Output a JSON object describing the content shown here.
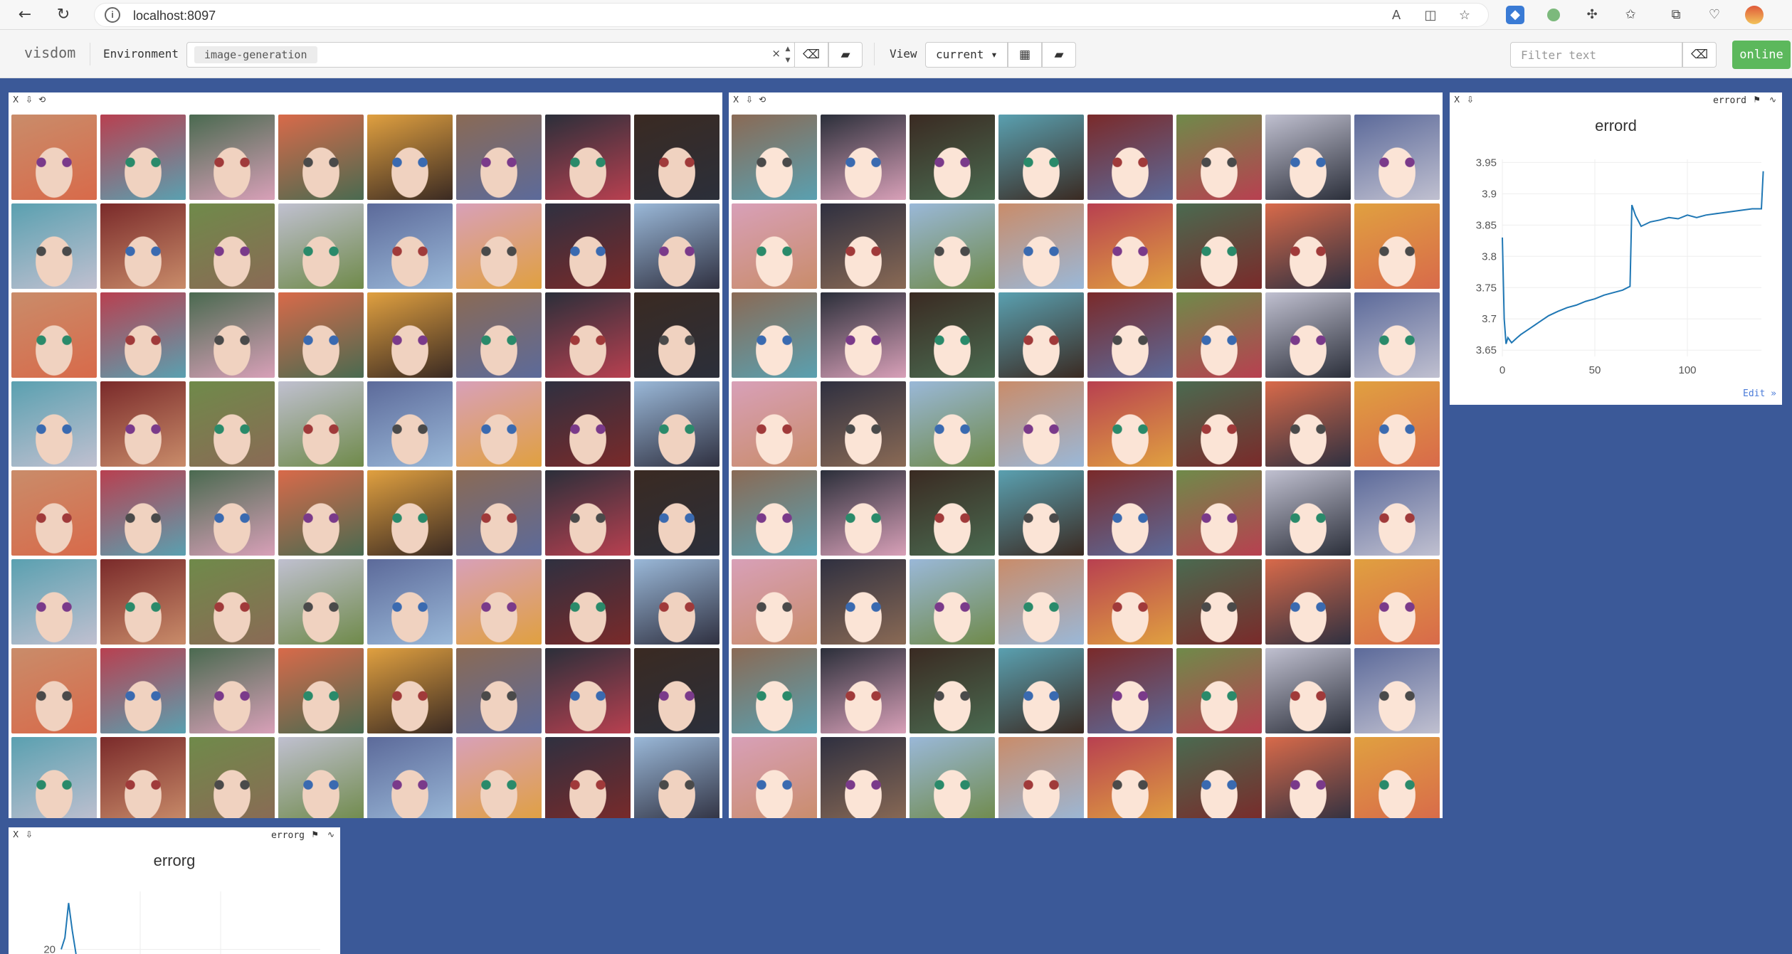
{
  "browser": {
    "url": "localhost:8097",
    "back_icon": "back-arrow-icon",
    "reload_icon": "reload-icon"
  },
  "visdom": {
    "brand": "visdom",
    "environment_label": "Environment",
    "environment_value": "image-generation",
    "clear_symbol": "×",
    "view_label": "View",
    "view_value": "current ▾",
    "filter_placeholder": "Filter text",
    "status": "online"
  },
  "panes": {
    "images_fake": {
      "controls": [
        "X",
        "⇩",
        "⟲"
      ],
      "rows": 8,
      "cols": 8
    },
    "images_real": {
      "controls": [
        "X",
        "⇩",
        "⟲"
      ],
      "rows": 8,
      "cols": 8
    },
    "errord": {
      "controls": [
        "X",
        "⇩"
      ],
      "title_tag": "errord",
      "edit_link": "Edit »"
    },
    "errorg": {
      "controls": [
        "X",
        "⇩"
      ],
      "title_tag": "errorg"
    }
  },
  "colors": {
    "page_bg": "#3b5998",
    "online_green": "#5cb85c",
    "line_blue": "#1f77b4"
  },
  "chart_data": [
    {
      "type": "line",
      "title": "errord",
      "xticks": [
        0,
        50,
        100
      ],
      "yticks": [
        3.65,
        3.7,
        3.75,
        3.8,
        3.85,
        3.9,
        3.95
      ],
      "xlim": [
        0,
        140
      ],
      "ylim": [
        3.64,
        3.955
      ],
      "grid": true,
      "series": [
        {
          "x": [
            0,
            1,
            2,
            3,
            5,
            8,
            10,
            15,
            20,
            25,
            30,
            35,
            40,
            45,
            50,
            55,
            60,
            65,
            69,
            70,
            72,
            75,
            80,
            85,
            90,
            95,
            100,
            105,
            110,
            115,
            120,
            125,
            130,
            135,
            140,
            141
          ],
          "y": [
            3.83,
            3.7,
            3.66,
            3.67,
            3.662,
            3.67,
            3.675,
            3.685,
            3.695,
            3.705,
            3.712,
            3.718,
            3.722,
            3.728,
            3.732,
            3.738,
            3.742,
            3.746,
            3.752,
            3.882,
            3.865,
            3.848,
            3.855,
            3.858,
            3.862,
            3.86,
            3.866,
            3.862,
            3.866,
            3.868,
            3.87,
            3.872,
            3.874,
            3.876,
            3.876,
            3.936
          ]
        }
      ]
    },
    {
      "type": "line",
      "title": "errorg",
      "xticks": [],
      "yticks": [
        20
      ],
      "ytick_labels": [
        "20"
      ],
      "xlim": [
        0,
        140
      ],
      "ylim": [
        18,
        45
      ],
      "grid": true,
      "series": [
        {
          "x": [
            0,
            2,
            4,
            6,
            8
          ],
          "y": [
            20,
            25,
            40,
            28,
            18
          ]
        }
      ]
    }
  ]
}
